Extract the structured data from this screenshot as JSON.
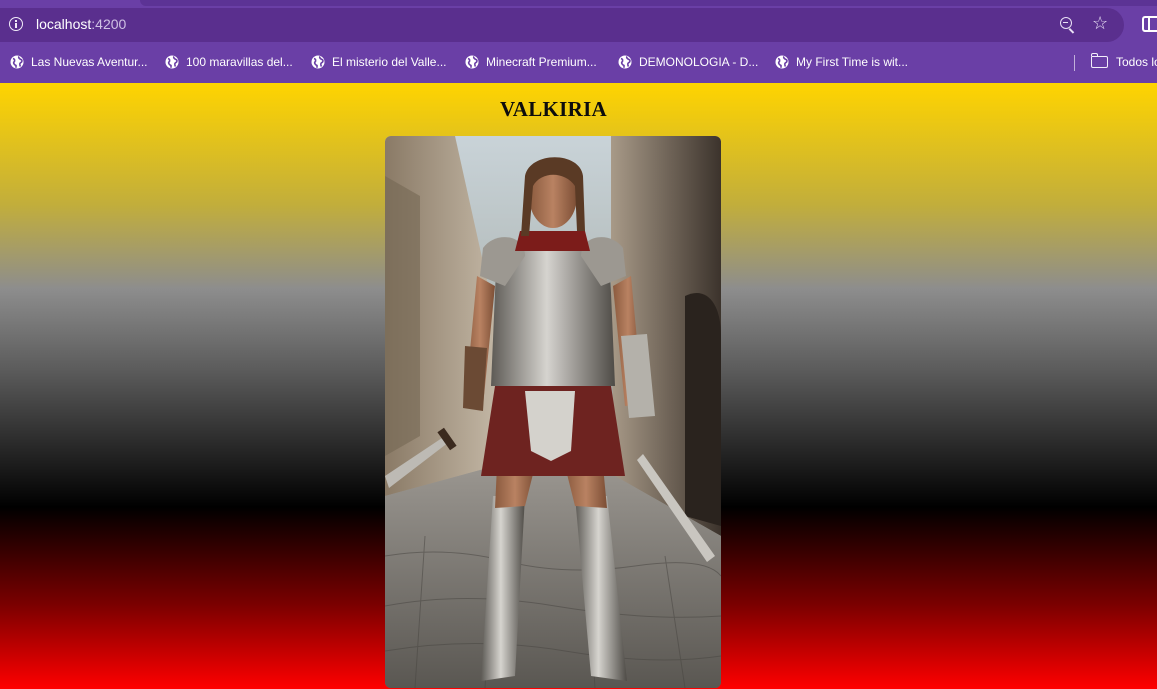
{
  "browser": {
    "url_host": "localhost",
    "url_port": ":4200",
    "bookmarks": [
      {
        "label": "Las Nuevas Aventur..."
      },
      {
        "label": "100 maravillas del..."
      },
      {
        "label": "El misterio del Valle..."
      },
      {
        "label": "Minecraft Premium..."
      },
      {
        "label": "DEMONOLOGIA - D..."
      },
      {
        "label": "My First Time is wit..."
      }
    ],
    "folder_label": "Todos lo"
  },
  "page": {
    "title": "VALKIRIA",
    "colors": {
      "gradient_top": "#ffd400",
      "gradient_middle": "#000000",
      "gradient_bottom": "#ff0000",
      "chrome_purple": "#6a3fa6"
    },
    "image_alt": "warrior-woman-with-swords"
  }
}
